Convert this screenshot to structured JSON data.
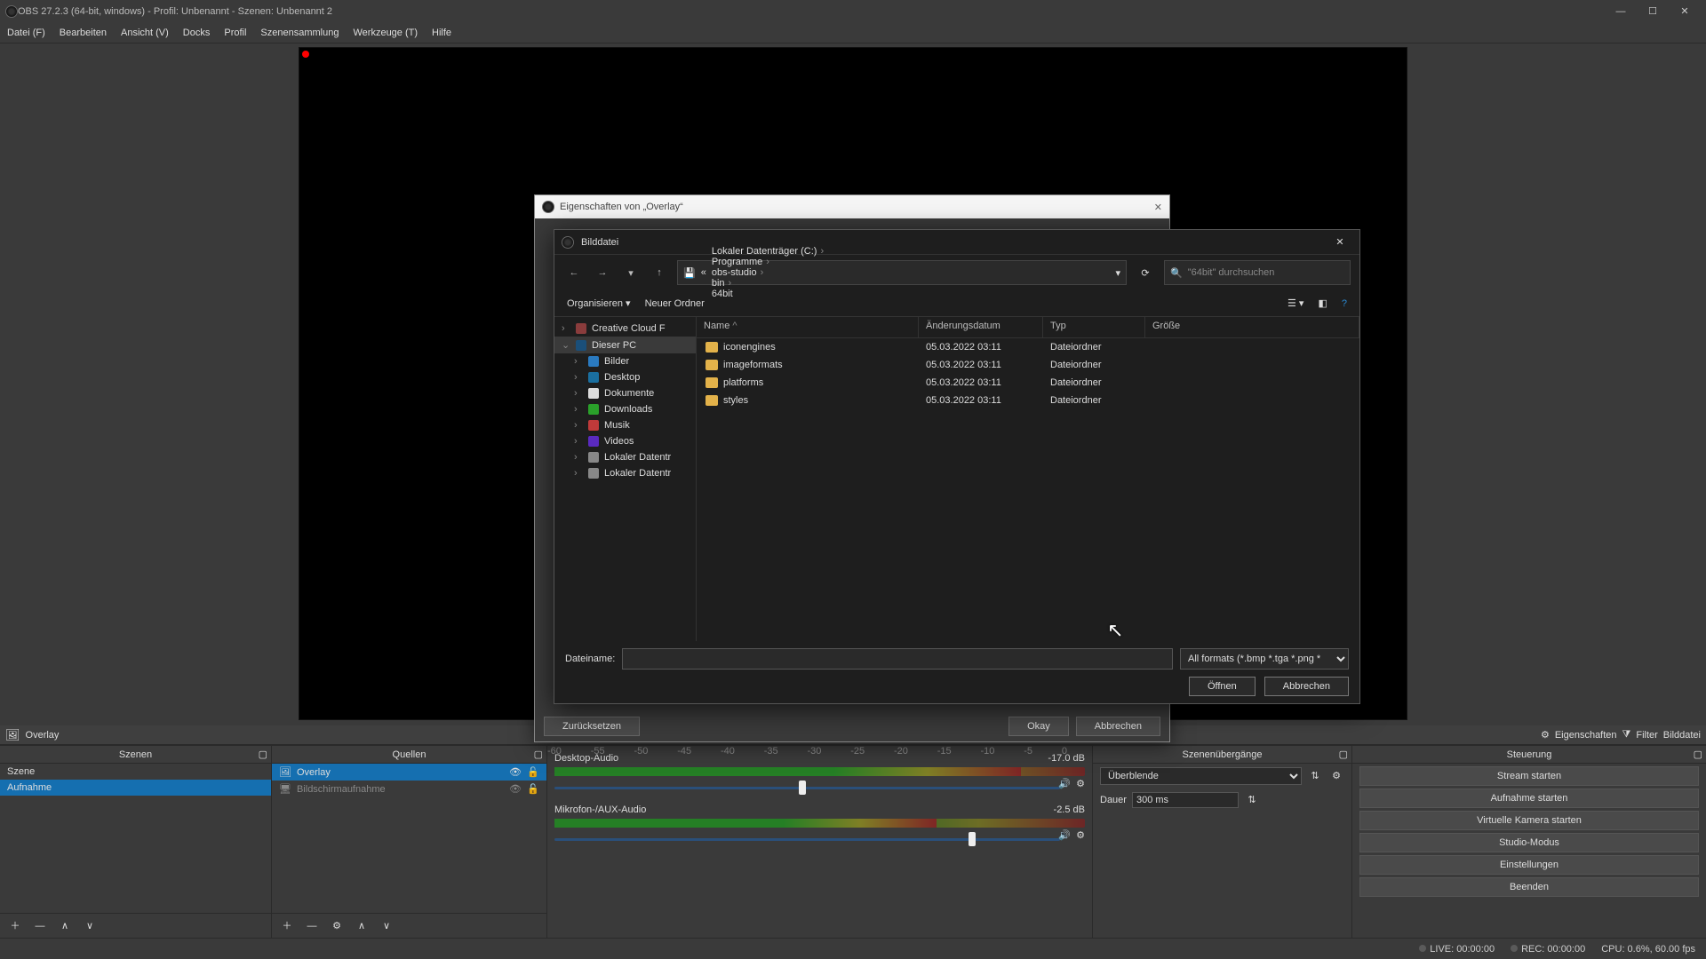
{
  "window": {
    "title": "OBS 27.2.3 (64-bit, windows) - Profil: Unbenannt - Szenen: Unbenannt 2"
  },
  "menu": {
    "file": "Datei (F)",
    "edit": "Bearbeiten",
    "view": "Ansicht (V)",
    "docks": "Docks",
    "profile": "Profil",
    "sceneCol": "Szenensammlung",
    "tools": "Werkzeuge (T)",
    "help": "Hilfe"
  },
  "toolbar": {
    "overlay": "Overlay",
    "props": "Eigenschaften",
    "filter": "Filter",
    "bild": "Bilddatei"
  },
  "docks": {
    "scenes": {
      "title": "Szenen",
      "item0": "Szene",
      "item1": "Aufnahme"
    },
    "sources": {
      "title": "Quellen",
      "item0": "Overlay",
      "item1": "Bildschirmaufnahme"
    },
    "transitions": {
      "title": "Szenenübergänge",
      "trans": "Überblende",
      "durationLabel": "Dauer",
      "duration": "300 ms"
    },
    "controls": {
      "title": "Steuerung",
      "b0": "Stream starten",
      "b1": "Aufnahme starten",
      "b2": "Virtuelle Kamera starten",
      "b3": "Studio-Modus",
      "b4": "Einstellungen",
      "b5": "Beenden"
    }
  },
  "mixer": {
    "track0": {
      "name": "Desktop-Audio",
      "db": "-17.0 dB"
    },
    "track1": {
      "name": "Mikrofon-/AUX-Audio",
      "db": "-2.5 dB"
    }
  },
  "propDlg": {
    "title": "Eigenschaften von „Overlay“",
    "reset": "Zurücksetzen",
    "ok": "Okay",
    "cancel": "Abbrechen"
  },
  "fileDlg": {
    "title": "Bilddatei",
    "crumbRoot": "«",
    "crumbs": [
      "Lokaler Datenträger (C:)",
      "Programme",
      "obs-studio",
      "bin",
      "64bit"
    ],
    "searchPh": "\"64bit\" durchsuchen",
    "organize": "Organisieren",
    "newFolder": "Neuer Ordner",
    "cols": {
      "name": "Name",
      "date": "Änderungsdatum",
      "type": "Typ",
      "size": "Größe"
    },
    "rows": [
      {
        "name": "iconengines",
        "date": "05.03.2022 03:11",
        "type": "Dateiordner"
      },
      {
        "name": "imageformats",
        "date": "05.03.2022 03:11",
        "type": "Dateiordner"
      },
      {
        "name": "platforms",
        "date": "05.03.2022 03:11",
        "type": "Dateiordner"
      },
      {
        "name": "styles",
        "date": "05.03.2022 03:11",
        "type": "Dateiordner"
      }
    ],
    "side": {
      "cc": "Creative Cloud F",
      "pc": "Dieser PC",
      "img": "Bilder",
      "desk": "Desktop",
      "doc": "Dokumente",
      "dl": "Downloads",
      "mus": "Musik",
      "vid": "Videos",
      "drv1": "Lokaler Datentr",
      "drv2": "Lokaler Datentr"
    },
    "fnLabel": "Dateiname:",
    "filter": "All formats (*.bmp *.tga *.png *",
    "open": "Öffnen",
    "cancel": "Abbrechen"
  },
  "status": {
    "live": "LIVE: 00:00:00",
    "rec": "REC: 00:00:00",
    "cpu": "CPU: 0.6%, 60.00 fps"
  }
}
